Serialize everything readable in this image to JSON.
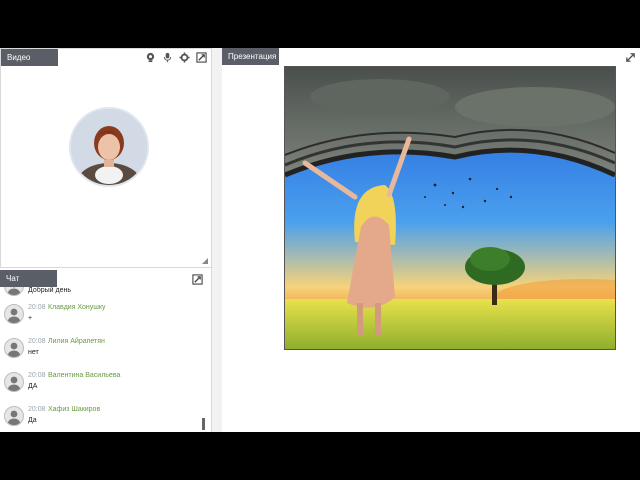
{
  "video": {
    "tab_label": "Видео"
  },
  "presentation": {
    "tab_label": "Презентация"
  },
  "chat": {
    "tab_label": "Чат",
    "messages": [
      {
        "time": "",
        "name": "",
        "text": "Добрый день"
      },
      {
        "time": "20:08",
        "name": "Клавдия Хонушку",
        "text": "+"
      },
      {
        "time": "20:08",
        "name": "Лилия Айрапетян",
        "text": "нет"
      },
      {
        "time": "20:08",
        "name": "Валентина Васильева",
        "text": "ДА"
      },
      {
        "time": "20:08",
        "name": "Хафиз Шакиров",
        "text": "Да"
      }
    ]
  },
  "icons": {
    "webcam": "webcam-icon",
    "microphone": "microphone-icon",
    "settings": "gear-icon",
    "expand": "expand-icon"
  },
  "colors": {
    "tab_bg": "#5a5e66",
    "chat_name": "#6a9a45",
    "chat_time": "#9aa3ad"
  }
}
